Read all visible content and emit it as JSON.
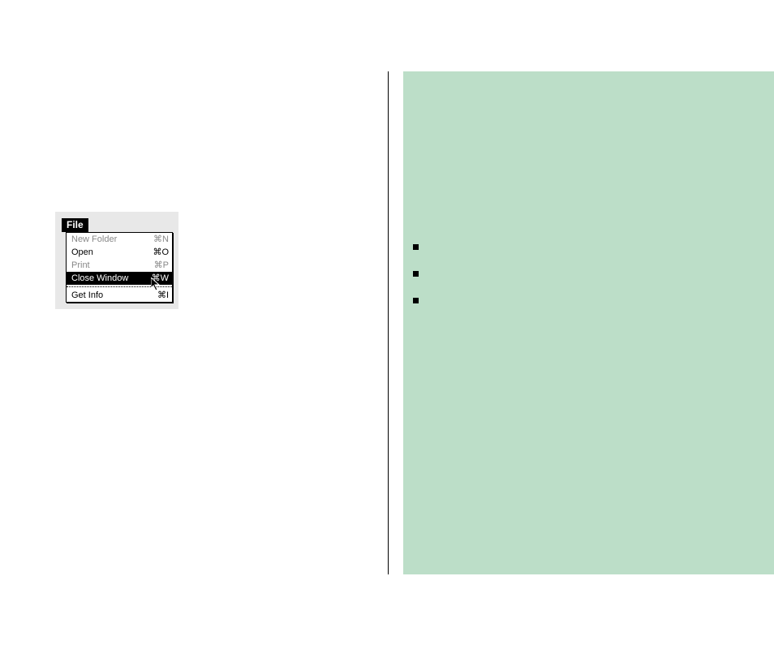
{
  "divider": true,
  "right_panel": {
    "bullets": [
      "",
      "",
      ""
    ]
  },
  "mac_menu": {
    "title": "File",
    "items": [
      {
        "label": "New Folder",
        "shortcut": "⌘N",
        "dim": true,
        "selected": false
      },
      {
        "label": "Open",
        "shortcut": "⌘O",
        "dim": false,
        "selected": false
      },
      {
        "label": "Print",
        "shortcut": "⌘P",
        "dim": true,
        "selected": false
      },
      {
        "label": "Close Window",
        "shortcut": "⌘W",
        "dim": false,
        "selected": true
      }
    ],
    "separator_after": 3,
    "last_item": {
      "label": "Get Info",
      "shortcut": "⌘I",
      "dim": false,
      "selected": false
    }
  }
}
